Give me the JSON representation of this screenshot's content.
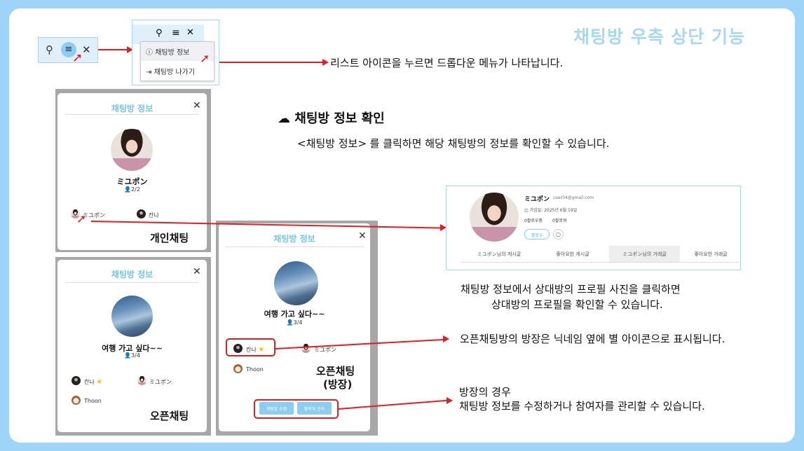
{
  "slide_title": "채팅방 우측 상단 기능",
  "menu": {
    "info_label": "채팅방 정보",
    "leave_label": "채팅방 나가기"
  },
  "notes": {
    "menu_desc": "리스트 아이콘을 누르면 드롭다운 메뉴가 나타납니다.",
    "section_title": "채팅방 정보 확인",
    "section_desc": "<채팅방 정보> 를 클릭하면 해당 채팅방의 정보를 확인할 수 있습니다.",
    "profile_desc_1": "채팅방 정보에서 상대방의 프로필 사진을 클릭하면",
    "profile_desc_2": "상대방의 프로필을 확인할 수 있습니다.",
    "star_desc": "오픈채팅방의 방장은 닉네임 옆에 별 아이콘으로 표시됩니다.",
    "owner_desc_1": "방장의 경우",
    "owner_desc_2": "채팅방 정보를 수정하거나 참여자를 관리할 수 있습니다."
  },
  "modal_personal": {
    "title": "채팅방 정보",
    "name": "ミユポン",
    "count": "2/2",
    "members": [
      "ミユポン",
      "칸나"
    ],
    "label": "개인채팅"
  },
  "modal_open": {
    "title": "채팅방 정보",
    "name": "여행 가고 싶다~~",
    "count": "3/4",
    "members": [
      "칸나",
      "ミユポン",
      "Thoon"
    ],
    "label": "오픈채팅"
  },
  "modal_owner": {
    "title": "채팅방 정보",
    "name": "여행 가고 싶다~~",
    "count": "3/4",
    "members": [
      "칸나",
      "ミユポン",
      "Thoon"
    ],
    "label1": "오픈채팅",
    "label2": "(방장)",
    "edit_btn": "채팅방 수정",
    "manage_btn": "참여자 관리"
  },
  "profile": {
    "name": "ミユポン",
    "email": "user04@gmail.com",
    "joined": "가입일: 2025년 6월 19일",
    "follower": "0팔로우중",
    "following": "0팔로워",
    "follow_btn": "팔로우",
    "tabs": [
      "ミユポン님의 게시글",
      "좋아요한 게시글",
      "ミユポン님의 거래글",
      "좋아요한 거래글"
    ]
  }
}
